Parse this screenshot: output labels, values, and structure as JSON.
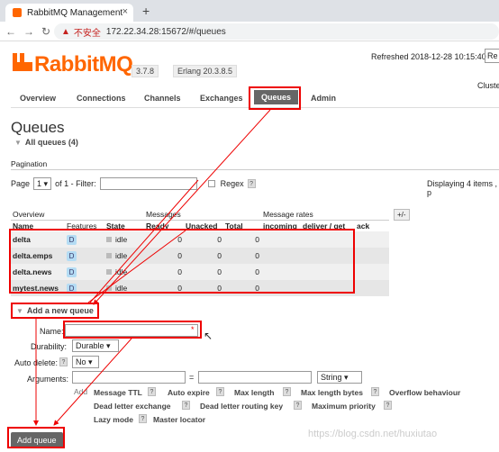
{
  "browser": {
    "tab_title": "RabbitMQ Management",
    "tab_close": "×",
    "new_tab": "+",
    "insecure_label": "不安全",
    "url": "172.22.34.28:15672/#/queues"
  },
  "header": {
    "logo_text": "RabbitMQ",
    "version": "3.7.8",
    "erlang": "Erlang 20.3.8.5",
    "refreshed": "Refreshed 2018-12-28 10:15:40",
    "refresh_select": "Re",
    "cluster": "Cluste"
  },
  "nav": {
    "items": [
      "Overview",
      "Connections",
      "Channels",
      "Exchanges",
      "Queues",
      "Admin"
    ],
    "active": "Queues"
  },
  "page": {
    "title": "Queues",
    "all_queues": "All queues (4)",
    "pagination_label": "Pagination",
    "page_label": "Page",
    "page_value": "1",
    "of_label": "of 1  - Filter:",
    "regex_label": "Regex",
    "help": "?",
    "displaying": "Displaying 4 items , p"
  },
  "table": {
    "group_headers": [
      "Overview",
      "Messages",
      "Message rates"
    ],
    "columns": [
      "Name",
      "Features",
      "State",
      "Ready",
      "Unacked",
      "Total",
      "incoming",
      "deliver / get",
      "ack"
    ],
    "plusminus": "+/-",
    "rows": [
      {
        "name": "delta",
        "feature": "D",
        "state": "idle",
        "ready": "0",
        "unacked": "0",
        "total": "0"
      },
      {
        "name": "delta.emps",
        "feature": "D",
        "state": "idle",
        "ready": "0",
        "unacked": "0",
        "total": "0"
      },
      {
        "name": "delta.news",
        "feature": "D",
        "state": "idle",
        "ready": "0",
        "unacked": "0",
        "total": "0"
      },
      {
        "name": "mytest.news",
        "feature": "D",
        "state": "idle",
        "ready": "0",
        "unacked": "0",
        "total": "0"
      }
    ]
  },
  "add_queue": {
    "section_title": "Add a new queue",
    "name_label": "Name:",
    "required_mark": "*",
    "durability_label": "Durability:",
    "durability_value": "Durable",
    "auto_delete_label": "Auto delete:",
    "auto_delete_value": "No",
    "arguments_label": "Arguments:",
    "equals": "=",
    "arg_type": "String",
    "add_label": "Add",
    "args_row1": [
      "Message TTL",
      "Auto expire",
      "Max length",
      "Max length bytes",
      "Overflow behaviour"
    ],
    "args_row2": [
      "Dead letter exchange",
      "Dead letter routing key",
      "Maximum priority"
    ],
    "args_row3": [
      "Lazy mode",
      "Master locator"
    ],
    "button": "Add queue"
  },
  "watermark": "https://blog.csdn.net/huxiutao",
  "colors": {
    "brand": "#ff6600",
    "highlight": "#e00000",
    "active_tab": "#666666"
  }
}
